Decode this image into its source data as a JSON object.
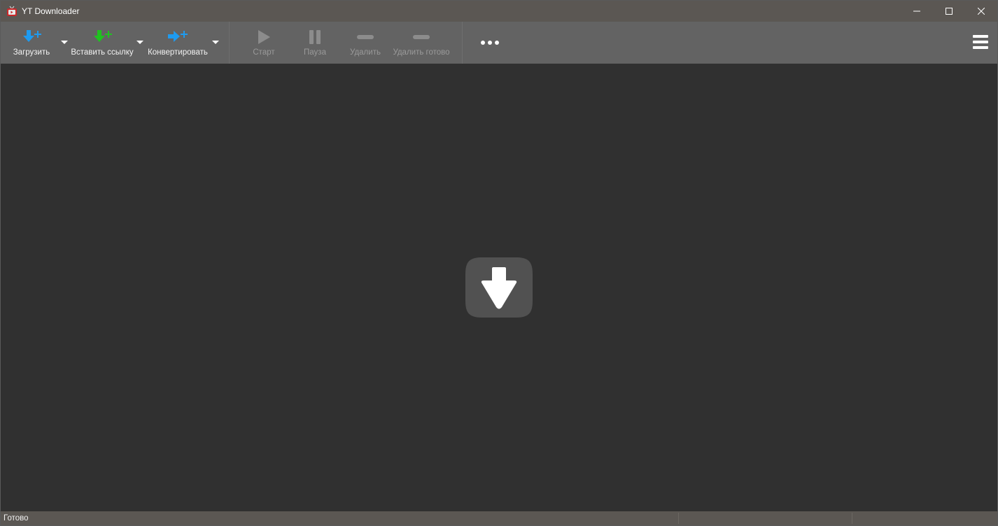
{
  "window": {
    "title": "YT Downloader",
    "icon": "app-tv-icon"
  },
  "toolbar": {
    "download_label": "Загрузить",
    "paste_link_label": "Вставить ссылку",
    "convert_label": "Конвертировать",
    "start_label": "Старт",
    "pause_label": "Пауза",
    "delete_label": "Удалить",
    "delete_done_label": "Удалить готово",
    "more_icon": "more-dots-icon",
    "menu_icon": "hamburger-menu-icon"
  },
  "colors": {
    "download_accent": "#1e9bf0",
    "paste_accent": "#1fc31f",
    "convert_accent": "#1e9bf0",
    "disabled": "#8c8c8c",
    "titlebar_bg": "#5b5753",
    "toolbar_bg": "#636363",
    "content_bg": "#303030"
  },
  "status": {
    "text": "Готово"
  }
}
